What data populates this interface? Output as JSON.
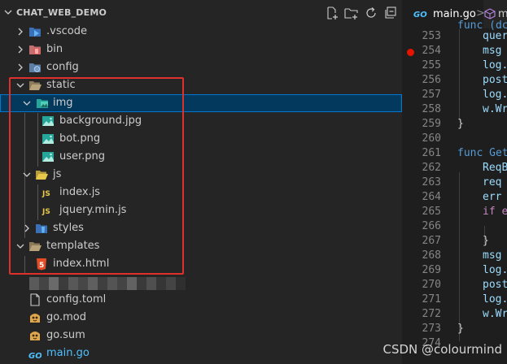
{
  "explorer": {
    "project_name": "CHAT_WEB_DEMO",
    "header_buttons": [
      "new-file-icon",
      "new-folder-icon",
      "refresh-icon",
      "collapse-all-icon"
    ],
    "tree": [
      {
        "label": ".vscode",
        "kind": "folder",
        "expanded": false,
        "depth": 1,
        "icon": "vscode-folder-icon"
      },
      {
        "label": "bin",
        "kind": "folder",
        "expanded": false,
        "depth": 1,
        "icon": "bin-folder-icon"
      },
      {
        "label": "config",
        "kind": "folder",
        "expanded": false,
        "depth": 1,
        "icon": "config-folder-icon"
      },
      {
        "label": "static",
        "kind": "folder",
        "expanded": true,
        "depth": 1,
        "icon": "folder-icon"
      },
      {
        "label": "img",
        "kind": "folder",
        "expanded": true,
        "depth": 2,
        "icon": "images-folder-icon",
        "selected": true
      },
      {
        "label": "background.jpg",
        "kind": "file",
        "depth": 3,
        "icon": "image-file-icon"
      },
      {
        "label": "bot.png",
        "kind": "file",
        "depth": 3,
        "icon": "image-file-icon"
      },
      {
        "label": "user.png",
        "kind": "file",
        "depth": 3,
        "icon": "image-file-icon"
      },
      {
        "label": "js",
        "kind": "folder",
        "expanded": true,
        "depth": 2,
        "icon": "js-folder-icon"
      },
      {
        "label": "index.js",
        "kind": "file",
        "depth": 3,
        "icon": "js-file-icon"
      },
      {
        "label": "jquery.min.js",
        "kind": "file",
        "depth": 3,
        "icon": "js-file-icon"
      },
      {
        "label": "styles",
        "kind": "folder",
        "expanded": false,
        "depth": 2,
        "icon": "styles-folder-icon"
      },
      {
        "label": "templates",
        "kind": "folder",
        "expanded": true,
        "depth": 1,
        "icon": "folder-icon"
      },
      {
        "label": "index.html",
        "kind": "file",
        "depth": 2,
        "icon": "html-file-icon"
      },
      {
        "label": "config.toml",
        "kind": "file",
        "depth": 1,
        "icon": "file-icon"
      },
      {
        "label": "go.mod",
        "kind": "file",
        "depth": 1,
        "icon": "go-mod-icon"
      },
      {
        "label": "go.sum",
        "kind": "file",
        "depth": 1,
        "icon": "go-mod-icon"
      },
      {
        "label": "main.go",
        "kind": "file",
        "depth": 1,
        "icon": "go-file-icon",
        "color": "#4fc1ff"
      }
    ]
  },
  "editor": {
    "tab": {
      "label": "main.go",
      "separator": ">",
      "breadcrumb": "m"
    },
    "lines": [
      {
        "n": "253",
        "code": "quer"
      },
      {
        "n": "254",
        "code": "msg ",
        "breakpoint": true
      },
      {
        "n": "255",
        "code": "log."
      },
      {
        "n": "256",
        "code": "post"
      },
      {
        "n": "257",
        "code": "log."
      },
      {
        "n": "258",
        "code": "w.Wr"
      },
      {
        "n": "259",
        "code": "}"
      },
      {
        "n": "260",
        "code": ""
      },
      {
        "n": "261",
        "code": "func Get"
      },
      {
        "n": "262",
        "code": "ReqB"
      },
      {
        "n": "263",
        "code": "req "
      },
      {
        "n": "264",
        "code": "err "
      },
      {
        "n": "265",
        "code": "if e"
      },
      {
        "n": "266",
        "code": ""
      },
      {
        "n": "267",
        "code": "}"
      },
      {
        "n": "268",
        "code": "msg "
      },
      {
        "n": "269",
        "code": "log."
      },
      {
        "n": "270",
        "code": "post"
      },
      {
        "n": "271",
        "code": "log."
      },
      {
        "n": "272",
        "code": "w.Wr"
      },
      {
        "n": "273",
        "code": "}"
      },
      {
        "n": "274",
        "code": ""
      }
    ],
    "partial_top_code": "func (dc"
  },
  "watermark": "CSDN @colourmind",
  "colors": {
    "accent": "#0078d4",
    "selection": "#04395e",
    "highlight_box": "#e0302b",
    "keyword": "#569cd6",
    "function": "#dcdcaa",
    "variable": "#9cdcfe"
  }
}
